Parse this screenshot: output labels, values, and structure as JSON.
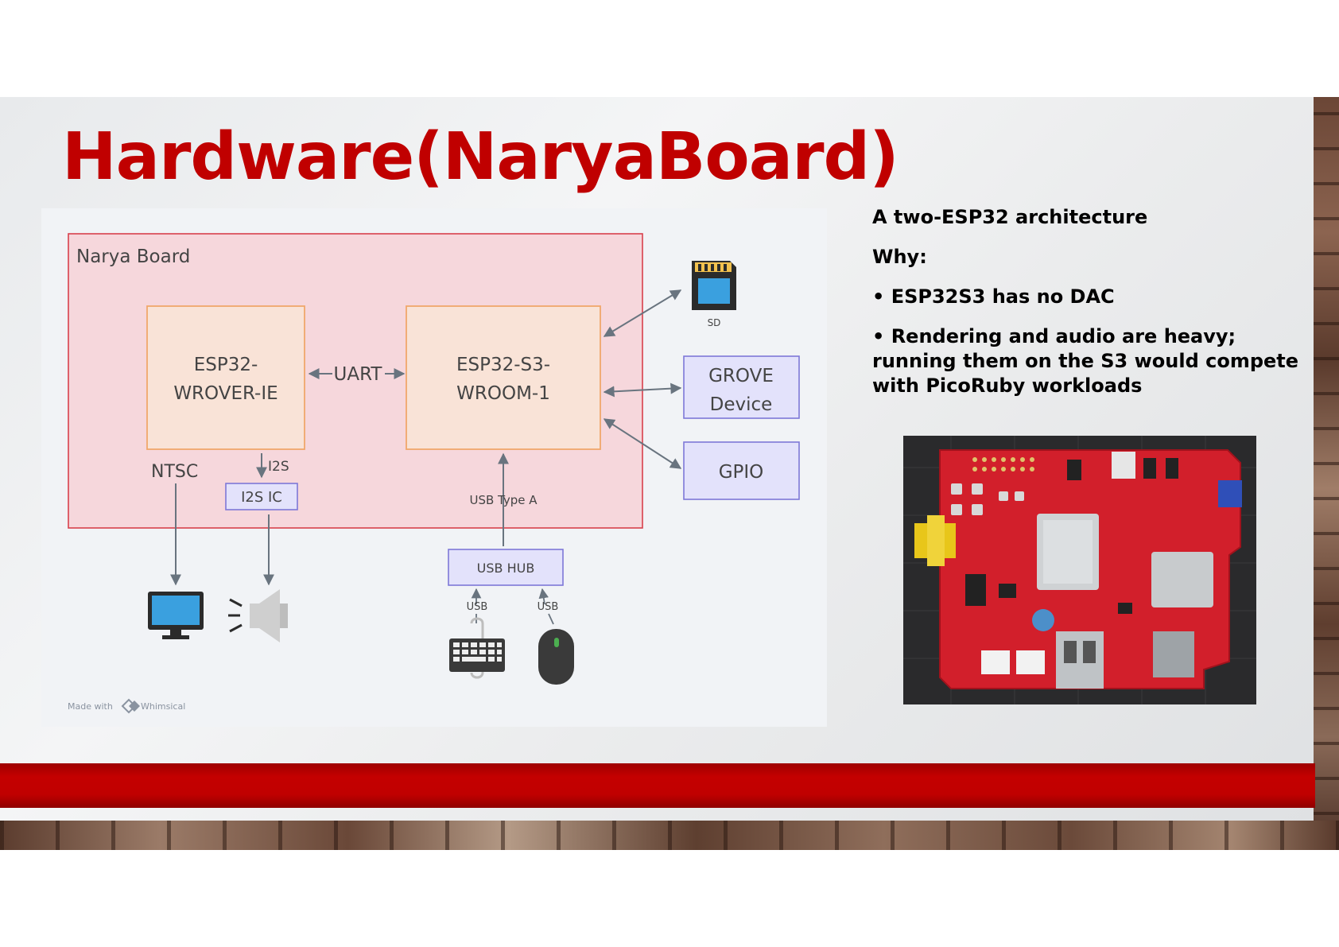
{
  "slide": {
    "title": "Hardware(NaryaBoard)"
  },
  "diagram": {
    "board_label": "Narya Board",
    "esp32_wrover": {
      "line1": "ESP32-",
      "line2": "WROVER-IE"
    },
    "esp32_s3": {
      "line1": "ESP32-S3-",
      "line2": "WROOM-1"
    },
    "uart_label": "UART",
    "ntsc_label": "NTSC",
    "i2s_label": "I2S",
    "i2s_ic_label": "I2S IC",
    "usb_type_a_label": "USB Type A",
    "usb_hub_label": "USB HUB",
    "usb_keyboard_label": "USB",
    "usb_mouse_label": "USB",
    "sd_label": "SD",
    "grove": {
      "line1": "GROVE",
      "line2": "Device"
    },
    "gpio_label": "GPIO",
    "watermark": {
      "made_with": "Made with",
      "brand": "Whimsical"
    },
    "icons": [
      "sd-card-icon",
      "monitor-icon",
      "speaker-icon",
      "keyboard-icon",
      "mouse-icon"
    ],
    "colors": {
      "board_fill": "#f6d7dc",
      "board_border": "#d8404c",
      "chip_fill": "#f9e3d7",
      "chip_border": "#f0a76b",
      "device_fill": "#e3e2fb",
      "device_border": "#7e78d8"
    }
  },
  "bullets": [
    "A two-ESP32 architecture",
    "Why:",
    "• ESP32S3 has no DAC",
    "• Rendering and audio are heavy; running them on the S3 would compete with PicoRuby workloads"
  ],
  "photo": {
    "name": "narya-board-photo"
  },
  "colors": {
    "title": "#c00000",
    "band": "#c00000"
  }
}
